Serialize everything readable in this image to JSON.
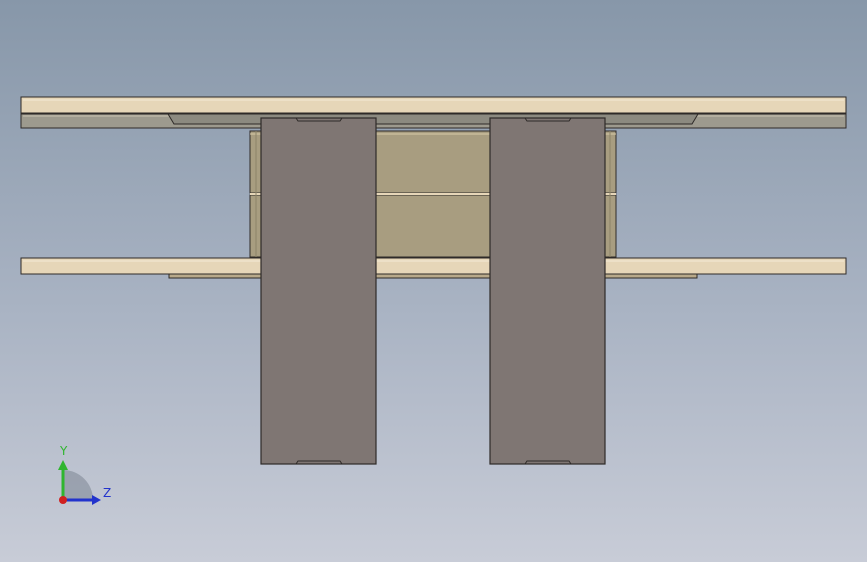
{
  "viewport": {
    "background_top": "#8797a9",
    "background_bottom": "#c8ccd7"
  },
  "model": {
    "plate_color": "#e6d6b8",
    "plate_shadow_color": "#b8a98a",
    "rail_color": "#9d9a8e",
    "block_color": "#a89d80",
    "panel_color": "#7f7673",
    "edge_color": "#2e2a28"
  },
  "triad": {
    "y_label": "Y",
    "z_label": "Z",
    "y_color": "#2fb52f",
    "z_color": "#2233cc",
    "x_color": "#d02020"
  }
}
